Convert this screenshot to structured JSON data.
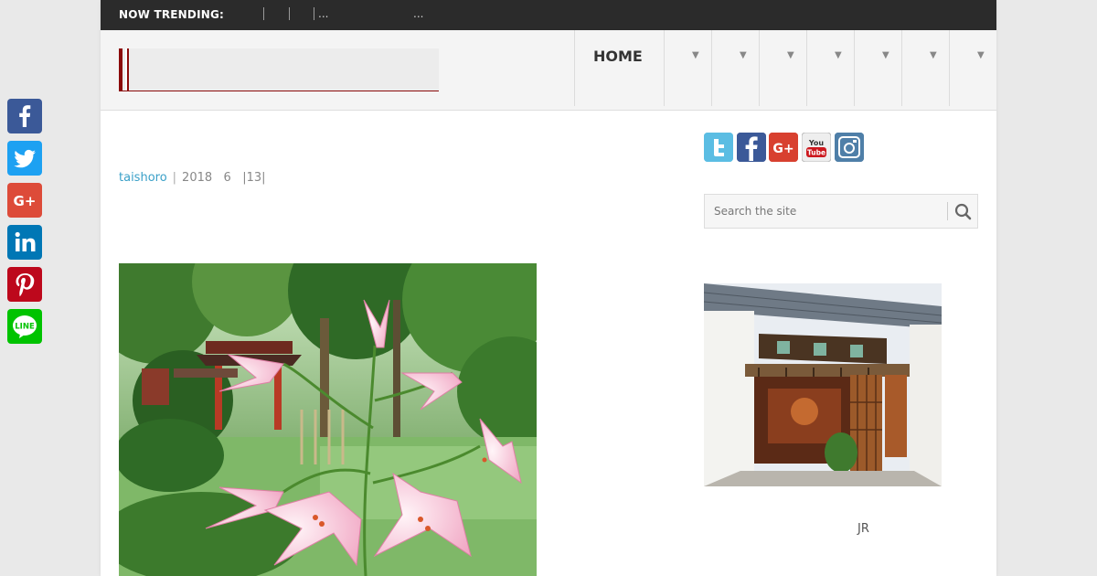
{
  "share": {
    "items": [
      {
        "name": "facebook",
        "icon": "facebook-icon",
        "color": "#3b5998"
      },
      {
        "name": "twitter",
        "icon": "twitter-icon",
        "color": "#1da1f2"
      },
      {
        "name": "google-plus",
        "icon": "google-plus-icon",
        "color": "#dd4b39"
      },
      {
        "name": "linkedin",
        "icon": "linkedin-icon",
        "color": "#0077b5"
      },
      {
        "name": "pinterest",
        "icon": "pinterest-icon",
        "color": "#bd081c"
      },
      {
        "name": "line",
        "icon": "line-icon",
        "color": "#00c300"
      }
    ],
    "gplus_text": "G+",
    "line_text": "LINE"
  },
  "trending": {
    "label": "NOW TRENDING:",
    "ellipsis_1": "...",
    "ellipsis_2": "..."
  },
  "nav": {
    "home": "HOME",
    "dropdown_glyph": "▼"
  },
  "post": {
    "author": "taishoro",
    "separator": "|",
    "year": "2018",
    "month": "6",
    "comments": "|13|"
  },
  "sidebar": {
    "social": {
      "youtube_text_1": "You",
      "youtube_text_2": "Tube"
    },
    "search": {
      "placeholder": "Search the site"
    },
    "caption": "JR"
  },
  "colors": {
    "accent": "#8b0b0b",
    "link": "#3aa0c8",
    "topbar": "#2b2b2b"
  }
}
